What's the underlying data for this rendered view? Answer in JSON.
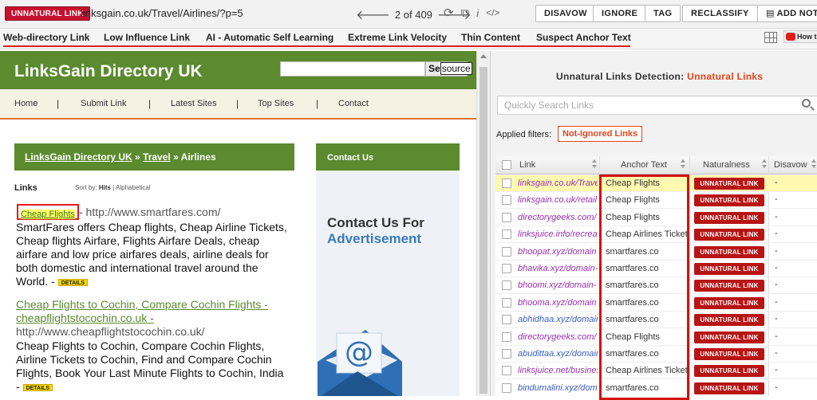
{
  "toolbar": {
    "badge": "UNNATURAL LINK",
    "url": "linksgain.co.uk/Travel/Airlines/?p=5",
    "pager_current": "2",
    "pager_total": "of 409",
    "buttons": {
      "disavow": "DISAVOW",
      "ignore": "IGNORE",
      "tag": "TAG",
      "reclassify": "RECLASSIFY",
      "add_note": "ADD NOT"
    },
    "icons": [
      "prev-arrow-icon",
      "next-arrow-icon",
      "refresh-icon",
      "external-link-icon",
      "info-icon",
      "code-icon"
    ]
  },
  "tags": [
    "Web-directory Link",
    "Low Influence Link",
    "AI - Automatic Self Learning",
    "Extreme Link Velocity",
    "Thin Content",
    "Suspect Anchor Text"
  ],
  "youtube_label": "How t",
  "site": {
    "title": "LinksGain Directory UK",
    "search_button": "Se",
    "search_button_hl": "source",
    "nav": [
      "Home",
      "Submit Link",
      "Latest Sites",
      "Top Sites",
      "Contact"
    ],
    "breadcrumb": {
      "home": "LinksGain Directory UK",
      "sep1": " » ",
      "category": "Travel",
      "sep2": " » ",
      "current": "Airlines"
    },
    "links_label": "Links",
    "sort_prefix": "Sort by:",
    "sort_hits": "Hits",
    "sort_sep": " | ",
    "sort_alpha": "Alphabetical",
    "entry1": {
      "title": "Cheap Flights",
      "url": "- http://www.smartfares.com/",
      "desc": "SmartFares offers Cheap flights, Cheap Airline Tickets, Cheap flights Airfare, Flights Airfare Deals, cheap airfare and low price airfares deals, airline deals for both domestic and international travel around the World. -",
      "details": "DETAILS"
    },
    "entry2": {
      "title": "Cheap Flights to Cochin, Compare Cochin Flights - cheapflightstocochin.co.uk",
      "title_suffix": " -",
      "url": "http://www.cheapflightstocochin.co.uk/",
      "desc": "Cheap Flights to Cochin, Compare Cochin Flights, Airline Tickets to Cochin, Find and Compare Cochin Flights, Book Your Last Minute Flights to Cochin, India -",
      "details": "DETAILS"
    },
    "contact_header": "Contact Us",
    "contact_big_line1": "Contact Us For",
    "contact_big_line2": "Advertisement"
  },
  "panel": {
    "title_prefix": "Unnatural Links Detection:",
    "title_highlight": "Unnatural Links",
    "search_placeholder": "Quickly Search Links",
    "filters_label": "Applied filters:",
    "filter_chip": "Not-Ignored Links",
    "columns": [
      "Link",
      "Anchor Text",
      "Naturalness",
      "Disavow"
    ],
    "rows": [
      {
        "link": "linksgain.co.uk/Travel/Airlines",
        "anchor": "Cheap Flights",
        "naturalness": "UNNATURAL LINK",
        "disavow": "-",
        "color": "purple",
        "selected": true
      },
      {
        "link": "linksgain.co.uk/retail",
        "anchor": "Cheap Flights",
        "naturalness": "UNNATURAL LINK",
        "disavow": "-",
        "color": "purple",
        "selected": false
      },
      {
        "link": "directorygeeks.com/",
        "anchor": "Cheap Flights",
        "naturalness": "UNNATURAL LINK",
        "disavow": "-",
        "color": "purple",
        "selected": false
      },
      {
        "link": "linksjuice.info/recreation",
        "anchor": "Cheap Airlines Tickets",
        "naturalness": "UNNATURAL LINK",
        "disavow": "-",
        "color": "purple",
        "selected": false
      },
      {
        "link": "bhoopat.xyz/domain",
        "anchor": "smartfares.co",
        "naturalness": "UNNATURAL LINK",
        "disavow": "-",
        "color": "purple",
        "selected": false
      },
      {
        "link": "bhavika.xyz/domain-",
        "anchor": "smartfares.co",
        "naturalness": "UNNATURAL LINK",
        "disavow": "-",
        "color": "purple",
        "selected": false
      },
      {
        "link": "bhoomi.xyz/domain-",
        "anchor": "smartfares.co",
        "naturalness": "UNNATURAL LINK",
        "disavow": "-",
        "color": "purple",
        "selected": false
      },
      {
        "link": "bhooma.xyz/domain",
        "anchor": "smartfares.co",
        "naturalness": "UNNATURAL LINK",
        "disavow": "-",
        "color": "purple",
        "selected": false
      },
      {
        "link": "abhidhaa.xyz/domain",
        "anchor": "smartfares.co",
        "naturalness": "UNNATURAL LINK",
        "disavow": "-",
        "color": "blue",
        "selected": false
      },
      {
        "link": "directorygeeks.com/",
        "anchor": "Cheap Flights",
        "naturalness": "UNNATURAL LINK",
        "disavow": "-",
        "color": "purple",
        "selected": false
      },
      {
        "link": "abudittaa.xyz/domain",
        "anchor": "smartfares.co",
        "naturalness": "UNNATURAL LINK",
        "disavow": "-",
        "color": "blue",
        "selected": false
      },
      {
        "link": "linksjuice.net/business",
        "anchor": "Cheap Airlines Tickets",
        "naturalness": "UNNATURAL LINK",
        "disavow": "-",
        "color": "purple",
        "selected": false
      },
      {
        "link": "bindumalini.xyz/dom",
        "anchor": "smartfares.co",
        "naturalness": "UNNATURAL LINK",
        "disavow": "-",
        "color": "blue",
        "selected": false
      }
    ]
  },
  "colors": {
    "unnatural_red": "#b81414",
    "site_green": "#5b8a2f",
    "accent_orange": "#e8431b",
    "highlight_red": "#e31b1b"
  }
}
